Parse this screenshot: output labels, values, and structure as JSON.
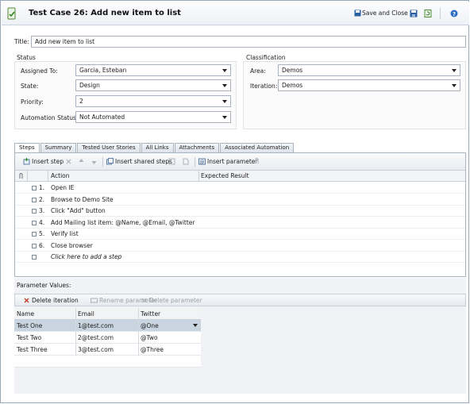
{
  "window": {
    "title": "Test Case 26: Add new item to list",
    "save_close_label": "Save and Close"
  },
  "fields": {
    "title_label": "Title:",
    "title_value": "Add new item to list"
  },
  "status": {
    "header": "Status",
    "assigned_to_label": "Assigned To:",
    "assigned_to_value": "Garcia, Esteban",
    "state_label": "State:",
    "state_value": "Design",
    "priority_label": "Priority:",
    "priority_value": "2",
    "automation_label": "Automation Status:",
    "automation_value": "Not Automated"
  },
  "classification": {
    "header": "Classification",
    "area_label": "Area:",
    "area_value": "Demos",
    "iteration_label": "Iteration:",
    "iteration_value": "Demos"
  },
  "tabs": [
    {
      "label": "Steps"
    },
    {
      "label": "Summary"
    },
    {
      "label": "Tested User Stories"
    },
    {
      "label": "All Links"
    },
    {
      "label": "Attachments"
    },
    {
      "label": "Associated Automation"
    }
  ],
  "steps_toolbar": {
    "insert_step": "Insert step",
    "insert_shared_steps": "Insert shared steps",
    "insert_parameter": "Insert parameter"
  },
  "steps_grid": {
    "col_action": "Action",
    "col_expected": "Expected Result",
    "rows": [
      {
        "num": "1.",
        "action": "Open IE"
      },
      {
        "num": "2.",
        "action": "Browse to Demo Site"
      },
      {
        "num": "3.",
        "action": "Click \"Add\" button"
      },
      {
        "num": "4.",
        "action": "Add Mailing list item: @Name, @Email, @Twitter"
      },
      {
        "num": "5.",
        "action": "Verify list"
      },
      {
        "num": "6.",
        "action": "Close browser"
      }
    ],
    "add_hint": "Click here to add a step"
  },
  "parameters": {
    "header": "Parameter Values:",
    "delete_iteration": "Delete iteration",
    "rename_parameter": "Rename parameter",
    "delete_parameter": "Delete parameter",
    "columns": [
      "Name",
      "Email",
      "Twitter"
    ],
    "rows": [
      {
        "name": "Test One",
        "email": "1@test.com",
        "twitter": "@One"
      },
      {
        "name": "Test Two",
        "email": "2@test.com",
        "twitter": "@Two"
      },
      {
        "name": "Test Three",
        "email": "3@test.com",
        "twitter": "@Three"
      }
    ]
  },
  "colors": {
    "accent": "#1f5fae",
    "selected_row": "#c8d4df",
    "border": "#a8b3c0"
  }
}
